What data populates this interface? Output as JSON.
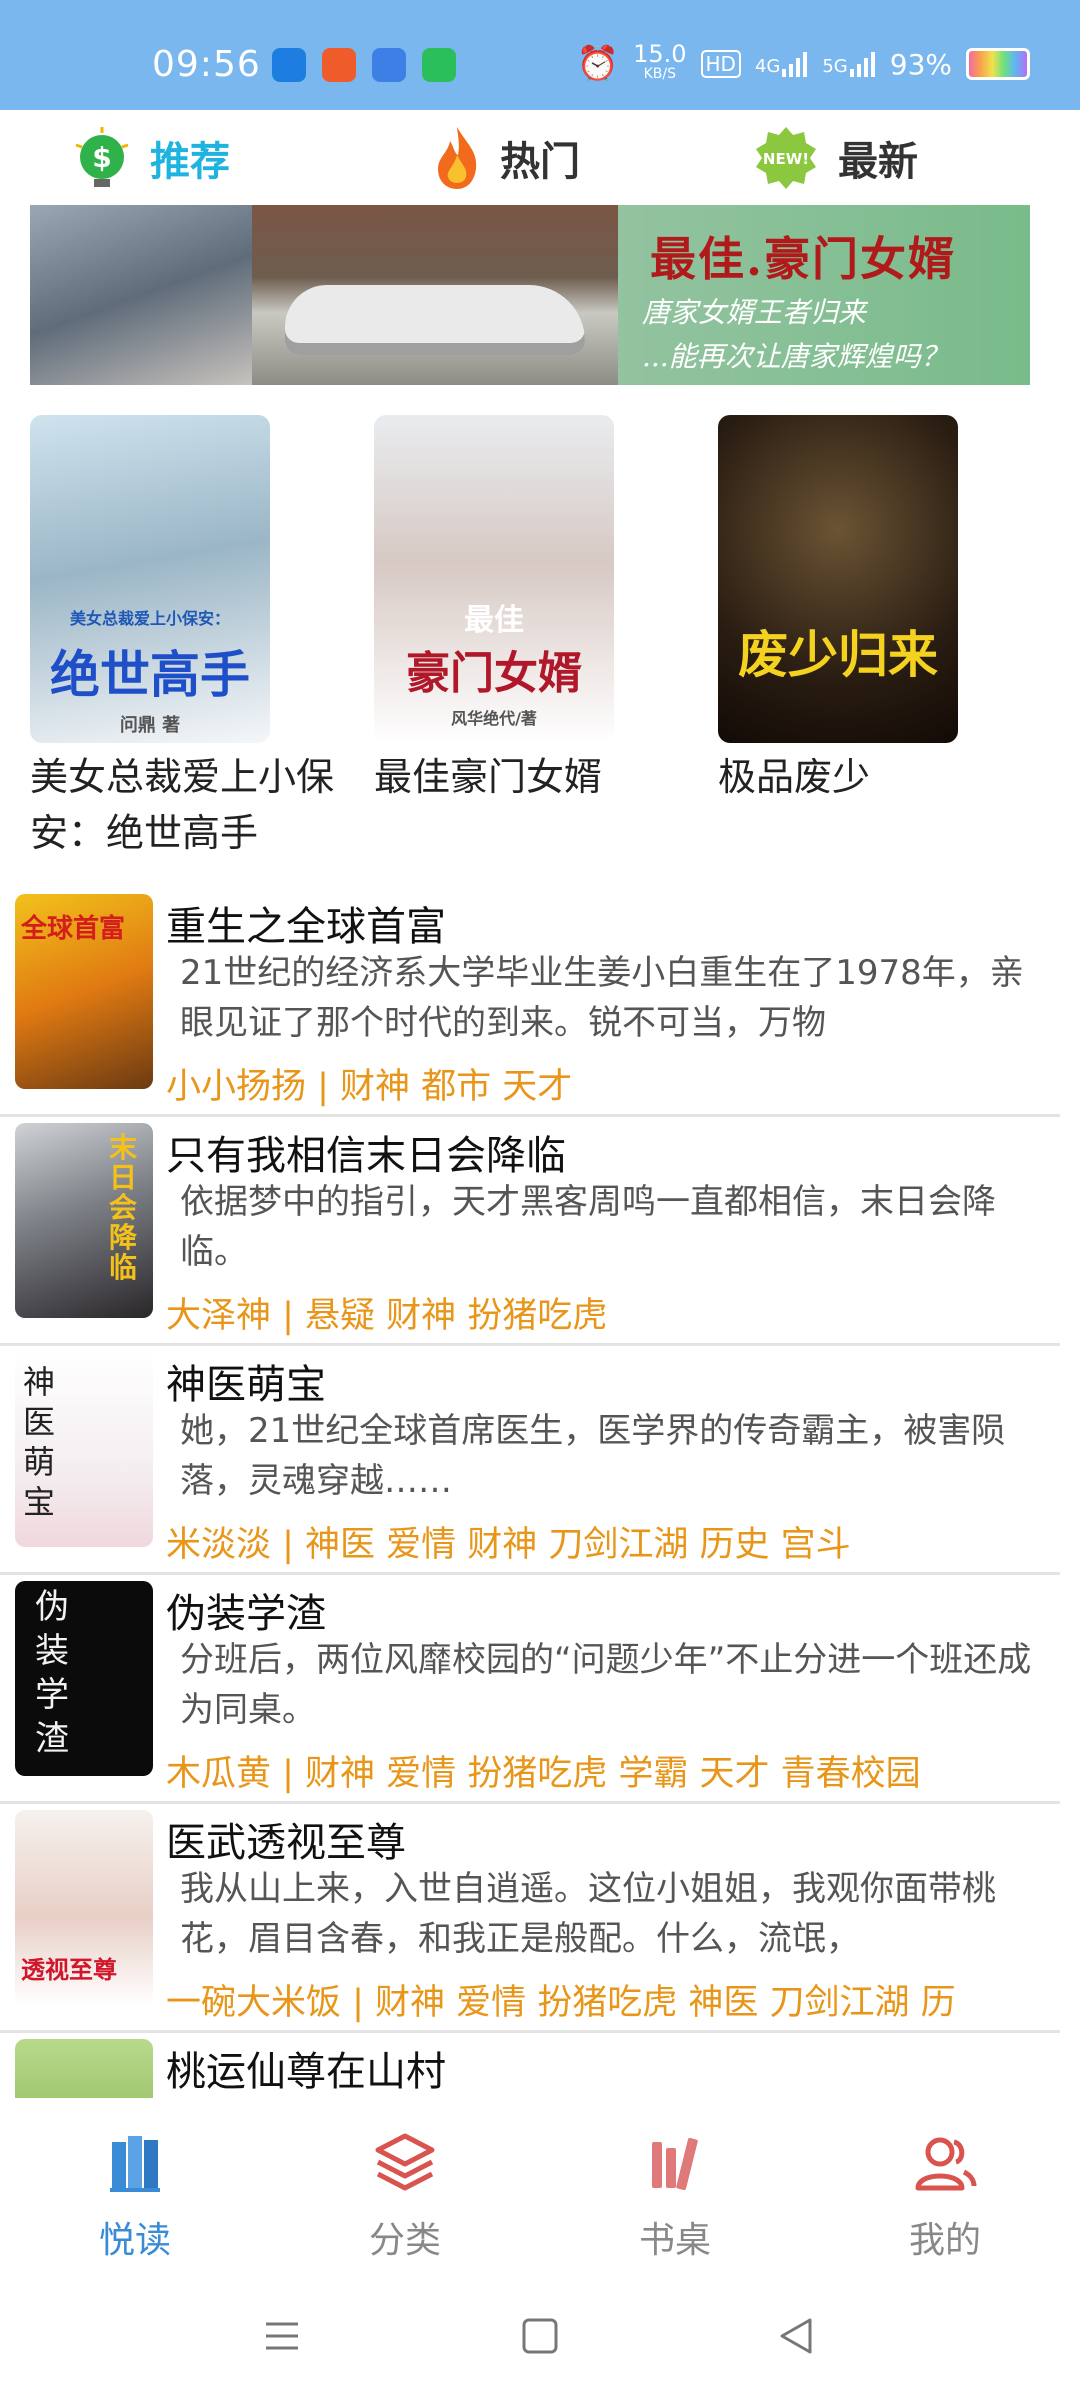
{
  "status_bar": {
    "time": "09:56",
    "net_speed": "15.0",
    "net_unit": "KB/S",
    "hd": "HD",
    "signal1": "4G",
    "signal2": "5G",
    "battery": "93%"
  },
  "tabs": {
    "recommend": "推荐",
    "hot": "热门",
    "newest": "最新"
  },
  "banner": {
    "title": "最佳.豪门女婿",
    "line1": "唐家女婿王者归来",
    "line2": "...能再次让唐家辉煌吗？"
  },
  "featured": [
    {
      "title": "美女总裁爱上小保安：绝世高手",
      "cover_small": "美女总裁爱上小保安：",
      "cover_big": "绝世高手",
      "cover_author": "问鼎 著"
    },
    {
      "title": "最佳豪门女婿",
      "cover_small": "最佳",
      "cover_big": "豪门女婿",
      "cover_author": "风华绝代/著"
    },
    {
      "title": "极品废少",
      "cover_big": "废少归来"
    }
  ],
  "books": [
    {
      "title": "重生之全球首富",
      "desc": "21世纪的经济系大学毕业生姜小白重生在了1978年，亲眼见证了那个时代的到来。锐不可当，万物",
      "tags": "小小扬扬 | 财神 都市 天才",
      "cover_text": "全球首富"
    },
    {
      "title": "只有我相信末日会降临",
      "desc": "依据梦中的指引，天才黑客周鸣一直都相信，末日会降临。",
      "tags": "大泽神 | 悬疑 财神 扮猪吃虎",
      "cover_text": "末日会降临"
    },
    {
      "title": "神医萌宝",
      "desc": "她，21世纪全球首席医生，医学界的传奇霸主，被害陨落，灵魂穿越……",
      "tags": "米淡淡 | 神医 爱情 财神 刀剑江湖 历史 宫斗",
      "cover_text": "神医萌宝"
    },
    {
      "title": "伪装学渣",
      "desc": "分班后，两位风靡校园的“问题少年”不止分进一个班还成为同桌。",
      "tags": "木瓜黄 | 财神 爱情 扮猪吃虎 学霸 天才 青春校园",
      "cover_text": "伪装学渣"
    },
    {
      "title": "医武透视至尊",
      "desc": "我从山上来，入世自逍遥。这位小姐姐，我观你面带桃花，眉目含春，和我正是般配。什么，流氓，",
      "tags": "一碗大米饭 | 财神 爱情 扮猪吃虎 神医 刀剑江湖 历",
      "cover_text": "透视至尊"
    },
    {
      "title": "桃运仙尊在山村",
      "desc": "",
      "tags": "",
      "cover_text": ""
    }
  ],
  "bottom_nav": {
    "read": "悦读",
    "category": "分类",
    "desk": "书桌",
    "mine": "我的"
  },
  "colors": {
    "status_bar": "#79b7ee",
    "accent": "#1fb3e0",
    "tag": "#e8961a",
    "nav_active": "#3a8bd5",
    "nav_icon_red": "#d9534f"
  }
}
